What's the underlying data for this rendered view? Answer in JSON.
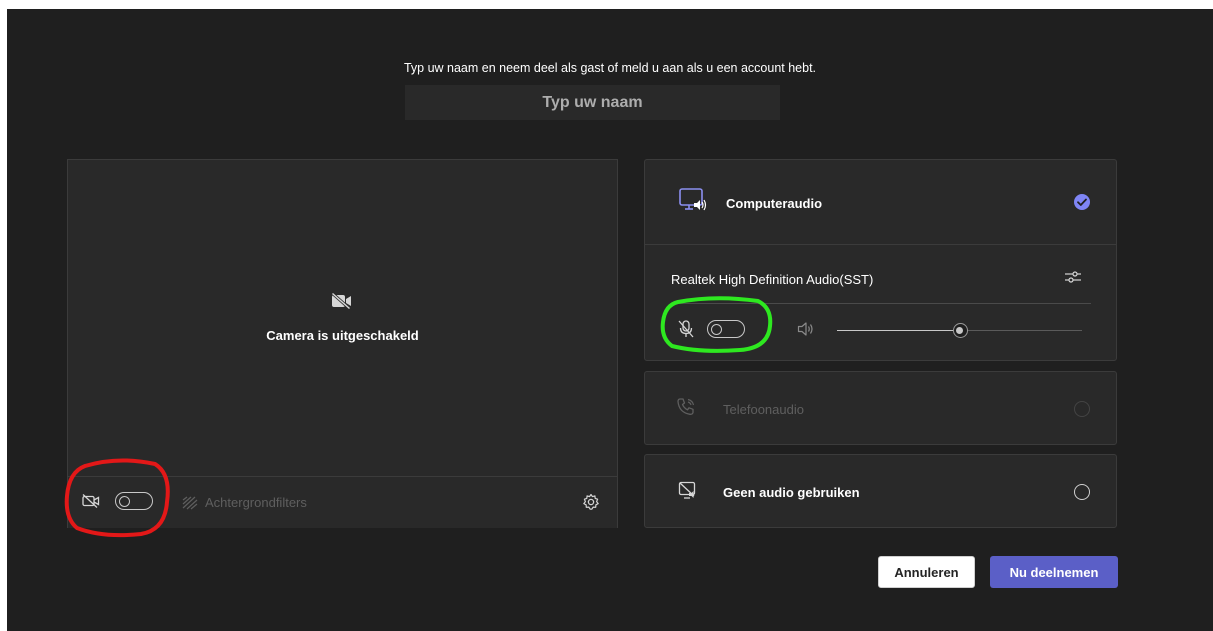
{
  "join": {
    "instruction": "Typ uw naam en neem deel als gast of meld u aan als u een account hebt.",
    "name_placeholder": "Typ uw naam",
    "name_value": ""
  },
  "video": {
    "status_text": "Camera is uitgeschakeld",
    "camera_toggle_on": false,
    "background_filters_label": "Achtergrondfilters"
  },
  "audio": {
    "computer_audio": {
      "label": "Computeraudio",
      "selected": true,
      "device_name": "Realtek High Definition Audio(SST)",
      "mic_toggle_on": false,
      "volume_fraction": 0.5
    },
    "phone_audio": {
      "label": "Telefoonaudio",
      "selected": false,
      "disabled": true
    },
    "no_audio": {
      "label": "Geen audio gebruiken",
      "selected": false
    }
  },
  "actions": {
    "cancel_label": "Annuleren",
    "join_label": "Nu deelnemen"
  },
  "colors": {
    "background": "#1f1f1f",
    "panel": "#292929",
    "accent": "#5b5fc7",
    "check": "#7f85f5",
    "annotation_red": "#e31818",
    "annotation_green": "#2ee820"
  }
}
